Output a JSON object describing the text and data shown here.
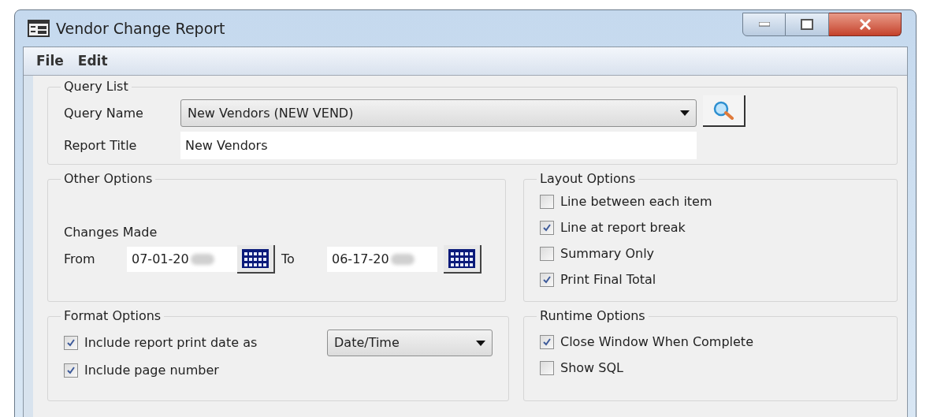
{
  "window": {
    "title": "Vendor Change Report"
  },
  "menu": [
    "File",
    "Edit"
  ],
  "query_list": {
    "title": "Query List",
    "query_name": {
      "label": "Query Name",
      "value": "New Vendors (NEW VEND)"
    },
    "report_title": {
      "label": "Report Title",
      "value": "New Vendors"
    }
  },
  "other_options": {
    "title": "Other Options",
    "changes_made": "Changes Made",
    "from": {
      "label": "From",
      "value": "07-01-20"
    },
    "to": {
      "label": "To",
      "value": "06-17-20"
    }
  },
  "layout_options": {
    "title": "Layout Options",
    "items": [
      {
        "label": "Line between each item",
        "checked": false
      },
      {
        "label": "Line at report break",
        "checked": true
      },
      {
        "label": "Summary Only",
        "checked": false
      },
      {
        "label": "Print Final Total",
        "checked": true
      }
    ]
  },
  "format_options": {
    "title": "Format Options",
    "items": [
      {
        "kind": "select",
        "label": "Include report print date as",
        "checked": true,
        "value": "Date/Time"
      },
      {
        "kind": "check",
        "label": "Include page number",
        "checked": true
      }
    ]
  },
  "runtime_options": {
    "title": "Runtime Options",
    "items": [
      {
        "label": "Close Window When Complete",
        "checked": true
      },
      {
        "label": "Show SQL",
        "checked": false
      }
    ]
  }
}
